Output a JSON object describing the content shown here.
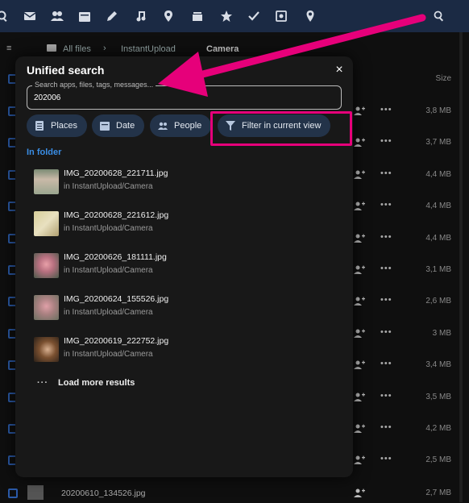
{
  "topbar": {
    "icons": [
      "search-icon-left",
      "mail-icon",
      "contacts-icon",
      "calendar-icon",
      "pen-icon",
      "music-icon",
      "location-icon",
      "deck-icon",
      "star-icon",
      "check-icon",
      "photos-icon",
      "map-pin-icon",
      "search-icon"
    ]
  },
  "breadcrumb": {
    "root": "All files",
    "folder": "InstantUpload",
    "current": "Camera"
  },
  "files": {
    "size_header": "Size",
    "rows": [
      {
        "size": "3,8 MB"
      },
      {
        "size": "3,7 MB"
      },
      {
        "size": "4,4 MB"
      },
      {
        "size": "4,4 MB"
      },
      {
        "size": "4,4 MB"
      },
      {
        "size": "3,1 MB"
      },
      {
        "size": "2,6 MB"
      },
      {
        "size": "3 MB"
      },
      {
        "size": "3,4 MB"
      },
      {
        "size": "3,5 MB"
      },
      {
        "size": "4,2 MB"
      },
      {
        "size": "2,5 MB"
      }
    ],
    "last_row": {
      "name": "20200610_134526.jpg",
      "size": "2,7 MB"
    }
  },
  "search_modal": {
    "title": "Unified search",
    "close_label": "×",
    "input_label": "Search apps, files, tags, messages...",
    "input_value": "202006",
    "filters": {
      "places": "Places",
      "date": "Date",
      "people": "People",
      "filter_view": "Filter in current view"
    },
    "section_title": "In folder",
    "results": [
      {
        "name": "IMG_20200628_221711.jpg",
        "path": "in InstantUpload/Camera"
      },
      {
        "name": "IMG_20200628_221612.jpg",
        "path": "in InstantUpload/Camera"
      },
      {
        "name": "IMG_20200626_181111.jpg",
        "path": "in InstantUpload/Camera"
      },
      {
        "name": "IMG_20200624_155526.jpg",
        "path": "in InstantUpload/Camera"
      },
      {
        "name": "IMG_20200619_222752.jpg",
        "path": "in InstantUpload/Camera"
      }
    ],
    "load_more": "Load more results",
    "load_more_dots": "···"
  },
  "colors": {
    "topbar": "#1b2a44",
    "accent": "#3a8ee6",
    "highlight": "#e6007a",
    "chip": "#233349"
  }
}
